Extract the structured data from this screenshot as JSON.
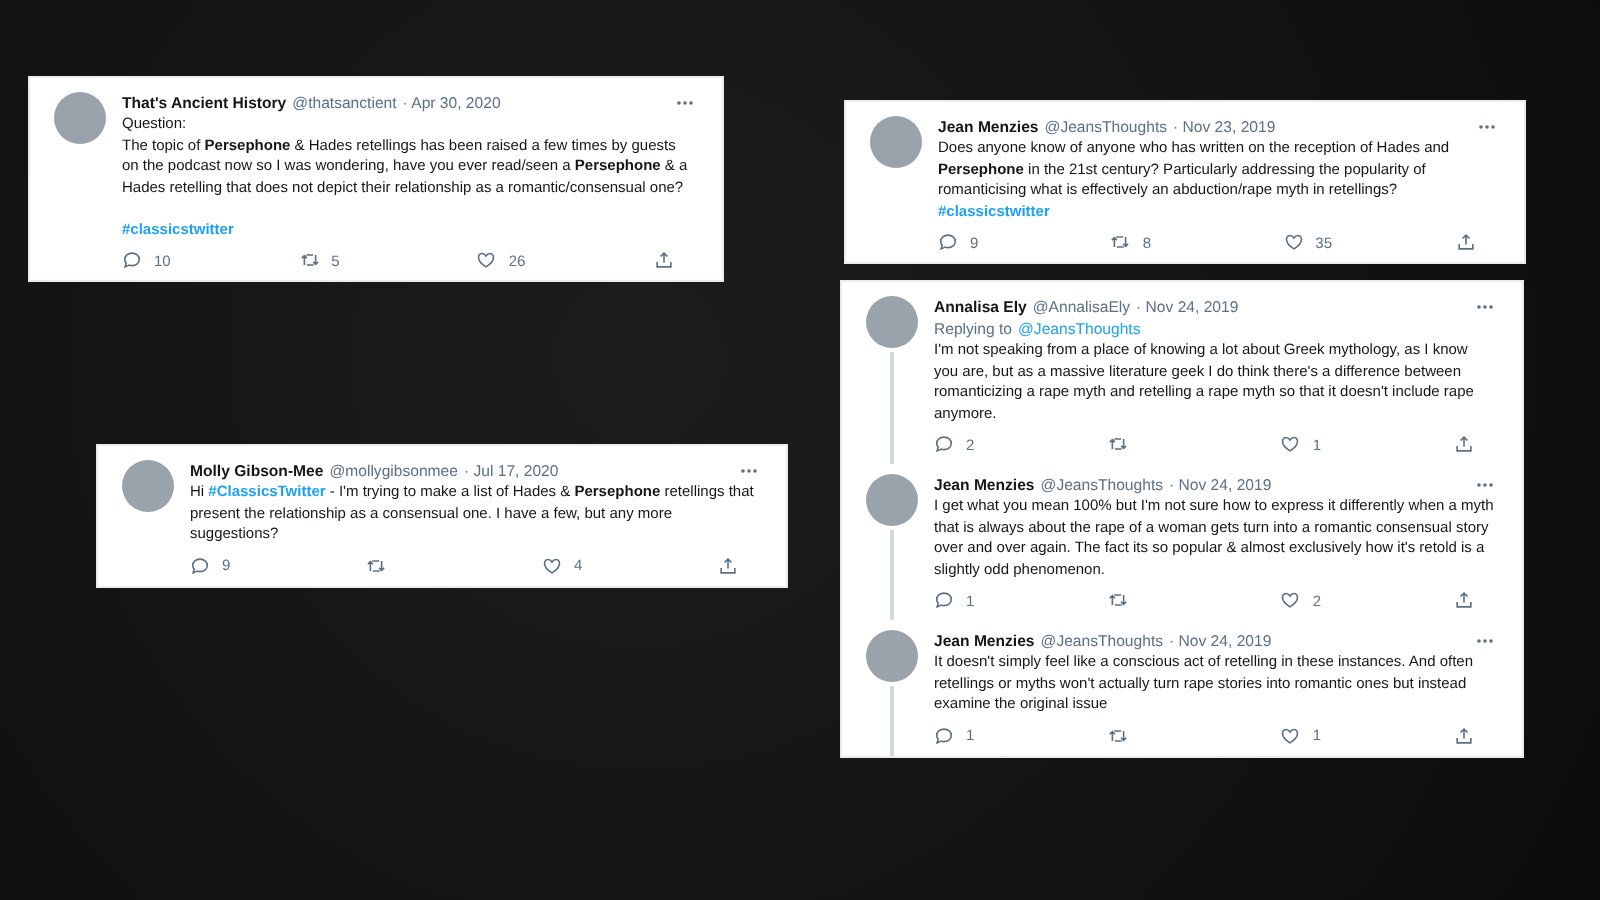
{
  "cards": [
    {
      "tweets": [
        {
          "name": "That's Ancient History",
          "handle": "@thatsanctient",
          "date": "· Apr 30, 2020",
          "paragraphs": [
            {
              "parts": [
                {
                  "kind": "text",
                  "text": "Question:"
                }
              ]
            },
            {
              "parts": [
                {
                  "kind": "text",
                  "text": "The topic of **Persephone** & Hades retellings has been raised a few times by guests on the podcast now so I was wondering, have you ever read/seen a **Persephone** & a Hades retelling that does not depict their relationship as a romantic/consensual one?"
                }
              ]
            },
            {
              "spaced": true,
              "parts": [
                {
                  "kind": "hashtag",
                  "text": "#classicstwitter"
                }
              ]
            }
          ],
          "replies": "10",
          "retweets": "5",
          "likes": "26",
          "thread_line": false
        }
      ]
    },
    {
      "tweets": [
        {
          "name": "Molly Gibson-Mee",
          "handle": "@mollygibsonmee",
          "date": "· Jul 17, 2020",
          "paragraphs": [
            {
              "parts": [
                {
                  "kind": "text",
                  "text": "Hi "
                },
                {
                  "kind": "hashtag",
                  "text": "#ClassicsTwitter"
                },
                {
                  "kind": "text",
                  "text": " - I'm trying to make a list of Hades & **Persephone** retellings that present the relationship as a consensual one. I have a few, but any more suggestions?"
                }
              ]
            }
          ],
          "replies": "9",
          "likes": "4",
          "thread_line": false
        }
      ]
    },
    {
      "tweets": [
        {
          "name": "Jean Menzies",
          "handle": "@JeansThoughts",
          "date": "· Nov 23, 2019",
          "paragraphs": [
            {
              "parts": [
                {
                  "kind": "text",
                  "text": "Does anyone know of anyone who has written on the  reception of Hades and **Persephone** in the 21st century? Particularly addressing the popularity of romanticising what is effectively an abduction/rape myth in retellings?"
                }
              ]
            },
            {
              "parts": [
                {
                  "kind": "hashtag",
                  "text": "#classicstwitter"
                }
              ]
            }
          ],
          "replies": "9",
          "retweets": "8",
          "likes": "35",
          "thread_line": false
        }
      ]
    },
    {
      "tweets": [
        {
          "name": "Annalisa Ely",
          "handle": "@AnnalisaEly",
          "date": "· Nov 24, 2019",
          "reply_prefix": "Replying to",
          "reply_to": "@JeansThoughts",
          "paragraphs": [
            {
              "parts": [
                {
                  "kind": "text",
                  "text": "I'm not speaking from a place of knowing a lot about Greek mythology, as I know you are, but as a massive literature geek I do think there's a difference between romanticizing a rape myth and retelling a rape myth so that it doesn't include rape anymore."
                }
              ]
            }
          ],
          "replies": "2",
          "likes": "1",
          "thread_line": true
        },
        {
          "name": "Jean Menzies",
          "handle": "@JeansThoughts",
          "date": "· Nov 24, 2019",
          "paragraphs": [
            {
              "parts": [
                {
                  "kind": "text",
                  "text": "I get what you mean 100% but I'm not sure how to express it differently when a myth that is always about the rape of a woman gets turn into a romantic consensual story over and over again. The fact its so popular & almost exclusively how it's retold is a slightly odd phenomenon."
                }
              ]
            }
          ],
          "replies": "1",
          "likes": "2",
          "thread_line": true
        },
        {
          "name": "Jean Menzies",
          "handle": "@JeansThoughts",
          "date": "· Nov 24, 2019",
          "paragraphs": [
            {
              "parts": [
                {
                  "kind": "text",
                  "text": "It doesn't simply feel like a conscious act of retelling in these instances. And often retellings or myths won't actually turn rape stories into romantic ones but instead examine the original issue"
                }
              ]
            }
          ],
          "replies": "1",
          "likes": "1",
          "thread_line": true
        }
      ]
    }
  ]
}
